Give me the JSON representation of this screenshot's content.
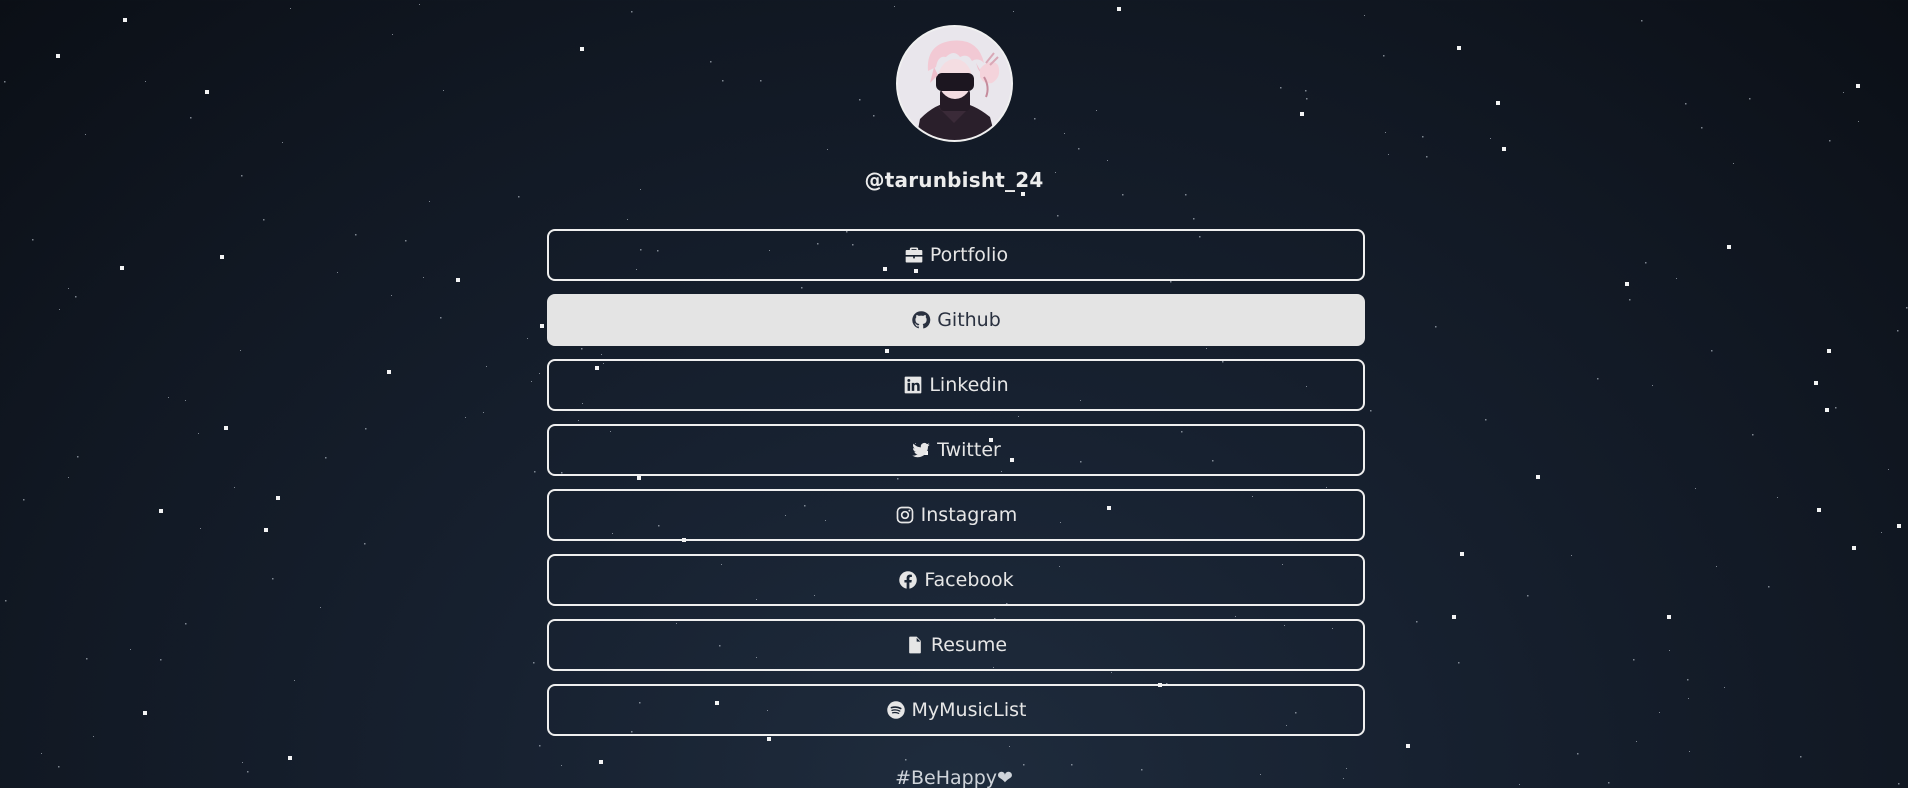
{
  "profile": {
    "username": "@tarunbisht_24",
    "avatar_icon": "anime-avatar-icon"
  },
  "links": [
    {
      "label": "Portfolio",
      "icon": "briefcase-icon",
      "active": false
    },
    {
      "label": "Github",
      "icon": "github-icon",
      "active": true
    },
    {
      "label": "Linkedin",
      "icon": "linkedin-icon",
      "active": false
    },
    {
      "label": "Twitter",
      "icon": "twitter-icon",
      "active": false
    },
    {
      "label": "Instagram",
      "icon": "instagram-icon",
      "active": false
    },
    {
      "label": "Facebook",
      "icon": "facebook-icon",
      "active": false
    },
    {
      "label": "Resume",
      "icon": "file-icon",
      "active": false
    },
    {
      "label": "MyMusicList",
      "icon": "spotify-icon",
      "active": false
    }
  ],
  "footer": {
    "text": "#BeHappy❤"
  },
  "colors": {
    "background": "#141c28",
    "button_border": "#efefef",
    "active_bg": "#e4e4e4",
    "active_text": "#2a3140"
  }
}
